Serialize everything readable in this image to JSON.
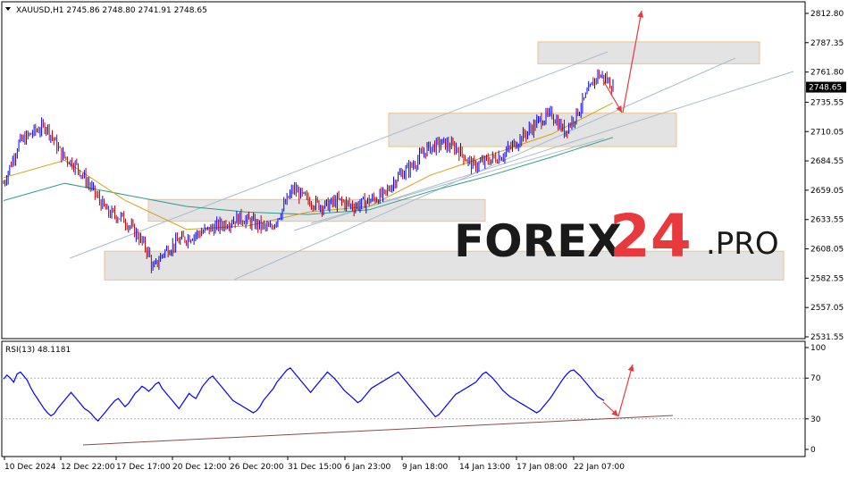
{
  "header": {
    "symbol": "XAUUSD,H1",
    "open": "2745.86",
    "high": "2748.80",
    "low": "2741.91",
    "close": "2748.65"
  },
  "current_price_label": "2748.65",
  "watermark": {
    "main": "FOREX",
    "num": "24",
    "suffix": ".PRO"
  },
  "rsi_header": "RSI(13) 48.1181",
  "colors": {
    "bull": "#0000ff",
    "bear": "#b40000",
    "ma_fast": "#d4a017",
    "ma_slow": "#2e9b8a",
    "channel": "#a9bccc",
    "zone_fill": "#e3e3e3",
    "zone_border": "#f0c089",
    "arrow": "#e8393c",
    "rsi_line": "#0000ff",
    "rsi_trend": "#8b4a4a"
  },
  "chart_data": [
    {
      "type": "candlestick",
      "title": "XAUUSD,H1",
      "price_ticks": [
        "2812.80",
        "2787.35",
        "2761.80",
        "2735.55",
        "2710.05",
        "2684.55",
        "2659.05",
        "2633.55",
        "2608.05",
        "2582.55",
        "2557.05",
        "2531.55"
      ],
      "ylim": [
        2531.55,
        2812.8
      ],
      "x_ticks": [
        "10 Dec 2024",
        "12 Dec 22:00",
        "17 Dec 17:00",
        "20 Dec 12:00",
        "26 Dec 20:00",
        "31 Dec 15:00",
        "6 Jan 23:00",
        "9 Jan 18:00",
        "14 Jan 13:00",
        "17 Jan 08:00",
        "22 Jan 07:00"
      ],
      "approx_close_path": [
        [
          0,
          2665
        ],
        [
          10,
          2700
        ],
        [
          20,
          2710
        ],
        [
          28,
          2715
        ],
        [
          38,
          2690
        ],
        [
          48,
          2680
        ],
        [
          58,
          2660
        ],
        [
          68,
          2640
        ],
        [
          78,
          2635
        ],
        [
          88,
          2620
        ],
        [
          95,
          2605
        ],
        [
          98,
          2590
        ],
        [
          105,
          2605
        ],
        [
          115,
          2615
        ],
        [
          125,
          2620
        ],
        [
          135,
          2625
        ],
        [
          145,
          2630
        ],
        [
          155,
          2635
        ],
        [
          165,
          2630
        ],
        [
          175,
          2625
        ],
        [
          182,
          2640
        ],
        [
          190,
          2660
        ],
        [
          200,
          2650
        ],
        [
          210,
          2645
        ],
        [
          220,
          2650
        ],
        [
          230,
          2645
        ],
        [
          240,
          2650
        ],
        [
          250,
          2655
        ],
        [
          258,
          2670
        ],
        [
          268,
          2680
        ],
        [
          278,
          2695
        ],
        [
          288,
          2700
        ],
        [
          298,
          2695
        ],
        [
          308,
          2680
        ],
        [
          318,
          2685
        ],
        [
          328,
          2690
        ],
        [
          336,
          2700
        ],
        [
          344,
          2710
        ],
        [
          352,
          2720
        ],
        [
          360,
          2725
        ],
        [
          368,
          2710
        ],
        [
          376,
          2725
        ],
        [
          384,
          2745
        ],
        [
          390,
          2760
        ],
        [
          396,
          2755
        ],
        [
          400,
          2748
        ]
      ],
      "zones": [
        {
          "from": 2769,
          "to": 2788
        },
        {
          "from": 2697,
          "to": 2726
        },
        {
          "from": 2632,
          "to": 2651
        },
        {
          "from": 2581,
          "to": 2606
        }
      ],
      "ma_fast_path": [
        [
          0,
          2670
        ],
        [
          40,
          2685
        ],
        [
          80,
          2650
        ],
        [
          120,
          2625
        ],
        [
          160,
          2628
        ],
        [
          200,
          2640
        ],
        [
          240,
          2645
        ],
        [
          280,
          2672
        ],
        [
          320,
          2690
        ],
        [
          360,
          2708
        ],
        [
          400,
          2735
        ]
      ],
      "ma_slow_path": [
        [
          0,
          2650
        ],
        [
          40,
          2665
        ],
        [
          80,
          2655
        ],
        [
          120,
          2645
        ],
        [
          160,
          2640
        ],
        [
          200,
          2638
        ],
        [
          240,
          2642
        ],
        [
          280,
          2658
        ],
        [
          320,
          2672
        ],
        [
          360,
          2688
        ],
        [
          400,
          2705
        ]
      ]
    },
    {
      "type": "line",
      "title": "RSI(13) 48.1181",
      "ylim": [
        0,
        100
      ],
      "y_ticks": [
        "100",
        "70",
        "30",
        "0"
      ],
      "levels": [
        70,
        30
      ],
      "values": [
        69,
        73,
        70,
        66,
        74,
        76,
        72,
        68,
        61,
        55,
        50,
        45,
        40,
        36,
        33,
        35,
        40,
        44,
        48,
        52,
        56,
        52,
        48,
        44,
        40,
        38,
        35,
        31,
        28,
        32,
        36,
        40,
        44,
        48,
        50,
        46,
        42,
        45,
        50,
        55,
        58,
        62,
        60,
        57,
        60,
        64,
        66,
        60,
        56,
        52,
        48,
        44,
        40,
        45,
        50,
        55,
        52,
        50,
        56,
        62,
        66,
        70,
        72,
        68,
        64,
        60,
        56,
        52,
        48,
        46,
        44,
        42,
        40,
        38,
        36,
        38,
        42,
        48,
        52,
        56,
        60,
        66,
        70,
        74,
        78,
        80,
        76,
        72,
        68,
        64,
        60,
        56,
        60,
        64,
        68,
        72,
        76,
        73,
        70,
        66,
        62,
        58,
        55,
        52,
        49,
        46,
        48,
        52,
        56,
        60,
        62,
        64,
        66,
        68,
        70,
        72,
        74,
        76,
        72,
        68,
        64,
        60,
        56,
        52,
        48,
        44,
        40,
        36,
        32,
        34,
        38,
        42,
        46,
        50,
        54,
        56,
        58,
        60,
        62,
        64,
        66,
        70,
        74,
        76,
        73,
        70,
        66,
        62,
        58,
        55,
        52,
        50,
        48,
        46,
        44,
        42,
        40,
        38,
        36,
        38,
        42,
        46,
        50,
        55,
        60,
        65,
        70,
        74,
        77,
        78,
        75,
        72,
        68,
        64,
        60,
        56,
        52,
        50,
        48
      ]
    }
  ]
}
